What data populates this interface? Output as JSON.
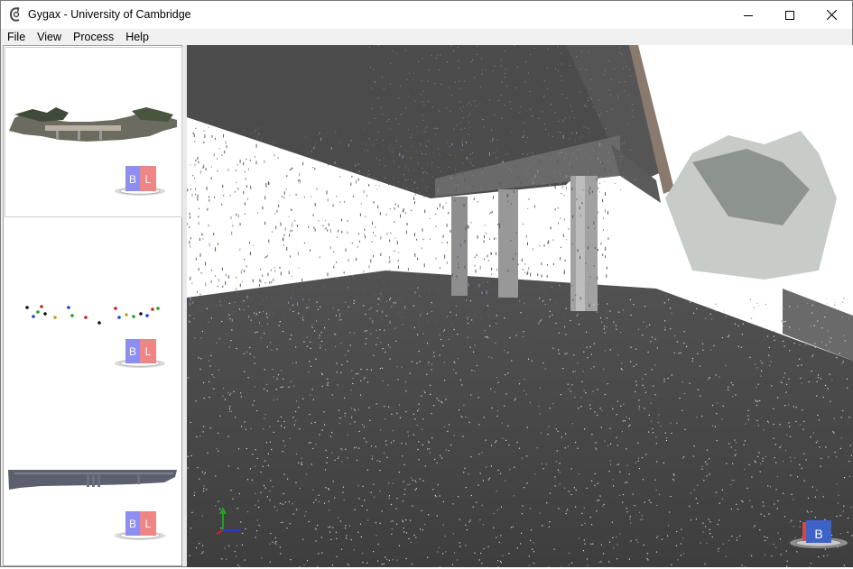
{
  "window": {
    "title": "Gygax - University of Cambridge",
    "controls": {
      "minimize": "minimize",
      "maximize": "maximize",
      "close": "close"
    }
  },
  "menu": {
    "items": [
      {
        "label": "File"
      },
      {
        "label": "View"
      },
      {
        "label": "Process"
      },
      {
        "label": "Help"
      }
    ]
  },
  "sidebar": {
    "thumbnails": [
      {
        "name": "point-cloud-overview",
        "cube_labels": [
          "B",
          "L"
        ],
        "selected": true
      },
      {
        "name": "control-points-view",
        "cube_labels": [
          "B",
          "L"
        ],
        "selected": false
      },
      {
        "name": "bridge-model-view",
        "cube_labels": [
          "B",
          "L"
        ],
        "selected": false
      }
    ]
  },
  "viewport": {
    "scene": "bridge-underside-point-cloud",
    "nav_cube_label": "B",
    "colors": {
      "background": "#4a4a4a",
      "points": "#e6e6e6",
      "deck": "#4b4b4b",
      "sky": "#ffffff"
    }
  }
}
